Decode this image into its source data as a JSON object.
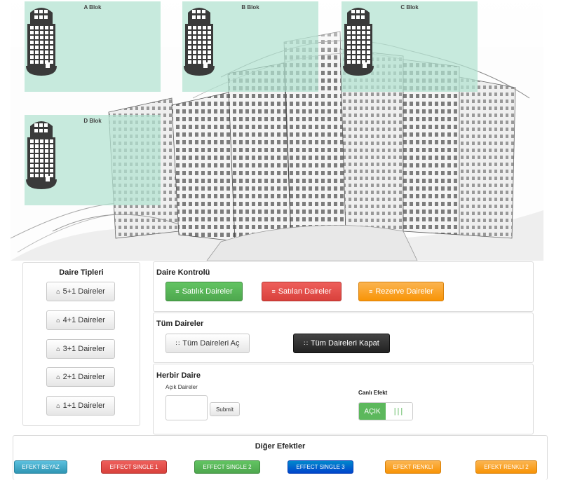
{
  "blocks": [
    {
      "label": "A Blok"
    },
    {
      "label": "B Blok"
    },
    {
      "label": "C Blok"
    },
    {
      "label": "D Blok"
    }
  ],
  "daire_tipleri": {
    "title": "Daire Tipleri",
    "items": [
      "5+1 Daireler",
      "4+1 Daireler",
      "3+1 Daireler",
      "2+1 Daireler",
      "1+1 Daireler"
    ]
  },
  "daire_kontrolu": {
    "title": "Daire Kontrolü",
    "satilik": "Satılık Daireler",
    "satilan": "Satılan Daireler",
    "rezerve": "Rezerve Daireler"
  },
  "tum_daireler": {
    "title": "Tüm Daireler",
    "ac": "Tüm Daireleri Aç",
    "kapat": "Tüm Daireleri Kapat"
  },
  "herbir_daire": {
    "title": "Herbir Daire",
    "acik_label": "Açık Daireler",
    "input_value": "",
    "submit": "Submit",
    "canli_label": "Canlı Efekt",
    "toggle_on": "AÇIK",
    "toggle_off_glyph": "|||",
    "toggle_state": "on"
  },
  "diger": {
    "title": "Diğer Efektler",
    "buttons": [
      "EFEKT BEYAZ",
      "EFFECT SINGLE 1",
      "EFFECT SINGLE 2",
      "EFFECT SINGLE 3",
      "EFEKT RENKLI",
      "EFEKT RENKLI 2"
    ]
  },
  "colors": {
    "overlay": "#b2e2d0",
    "tower": "#3a3a3a",
    "green": "#5cb85c",
    "red": "#d9534f",
    "orange": "#f89406",
    "dark": "#222222",
    "blue": "#0044cc",
    "cyan": "#2f96b4"
  },
  "icons": {
    "home": "home-icon",
    "list": "list-icon",
    "grid": "grid-icon"
  }
}
